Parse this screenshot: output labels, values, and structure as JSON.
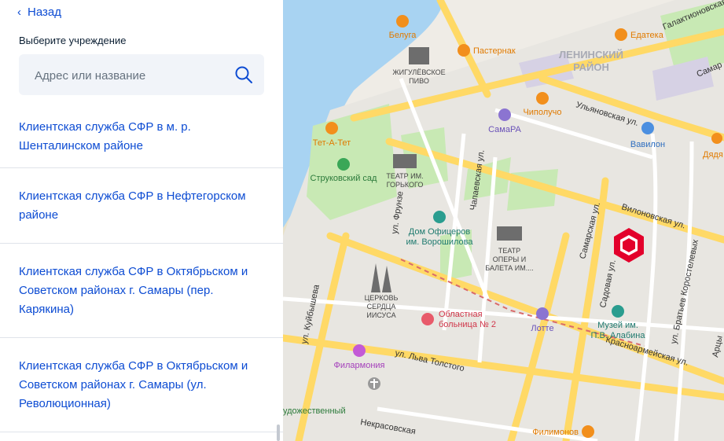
{
  "nav": {
    "back_label": "Назад"
  },
  "heading": "Выберите учреждение",
  "search": {
    "placeholder": "Адрес или название"
  },
  "items": [
    {
      "label": "Клиентская служба СФР в м. р. Шенталинском районе"
    },
    {
      "label": "Клиентская служба СФР в Нефтегорском районе"
    },
    {
      "label": "Клиентская служба СФР в Октябрьском и Советском районах г. Самары (пер. Карякина)"
    },
    {
      "label": "Клиентская служба СФР в Октябрьском и Советском районах г. Самары (ул. Революционная)"
    }
  ],
  "map": {
    "district": [
      "ЛЕНИНСКИЙ",
      "РАЙОН"
    ],
    "streets": {
      "galaktionovskaya": "Галактионовская ул.",
      "samar_edge": "Самар",
      "ulyanovskaya": "Ульяновская ул.",
      "chapaevskaya": "Чапаевская ул.",
      "frunze": "ул. Фрунзе",
      "samarskaya": "Самарская ул.",
      "vilonovskaya": "Вилоновская ул.",
      "sadovaya": "Садовая ул.",
      "bratyev_korostelevykh": "ул. Братьев Коростелевых",
      "artsy_edge": "Арцы",
      "kuybysheva": "ул. Куйбышева",
      "lva_tolstogo": "ул. Льва Толстого",
      "krasnoarmeyskaya": "Красноармейская ул.",
      "nekrasovskaya": "Некрасовская"
    },
    "pois": {
      "beluga": "Белуга",
      "pasternak": "Пастернак",
      "edatека": "Едатека",
      "zhigulevskoe": [
        "ЖИГУЛЁВСКОЕ",
        "ПИВО"
      ],
      "chipolucho": "Чиполучо",
      "samara": "СамаРА",
      "tet_a_tet": "Тет-А-Тет",
      "vavilon": "Вавилон",
      "dyadya_edge": "Дядя",
      "strukovsky": "Струковский сад",
      "gorky_theatre": [
        "ТЕАТР ИМ.",
        "ГОРЬКОГО"
      ],
      "dom_ofitserov": [
        "Дом Офицеров",
        "им. Ворошилова"
      ],
      "opera_theatre": [
        "ТЕАТР",
        "ОПЕРЫ И",
        "БАЛЕТА ИМ...."
      ],
      "church": [
        "ЦЕРКОВЬ",
        "СЕРДЦА",
        "ИИСУСА"
      ],
      "hospital": [
        "Областная",
        "больница № 2"
      ],
      "lotte": "Лотте",
      "alabin_museum": [
        "Музей им.",
        "П.В. Алабина"
      ],
      "philharmonia": "Филармония",
      "art_edge": "удожественный",
      "filimonov": "Филимонов"
    },
    "colors": {
      "accent": "#0d4cd3",
      "marker": "#e3002b",
      "water": "#a8d3f2",
      "park": "#c8e9b4",
      "road": "#ffd966"
    }
  }
}
